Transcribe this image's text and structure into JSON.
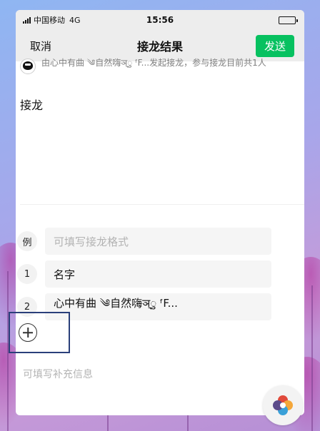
{
  "status_bar": {
    "carrier": "中国移动",
    "network": "4G",
    "time": "15:56"
  },
  "nav": {
    "cancel_label": "取消",
    "title": "接龙结果",
    "send_label": "发送"
  },
  "initiator": {
    "text": "由心中有曲 ༄自然嗨ञ्ु ᶠF...发起接龙，参与接龙目前共1人"
  },
  "topic": {
    "text": "接龙"
  },
  "rows": [
    {
      "badge": "例",
      "text": "可填写接龙格式",
      "placeholder": true
    },
    {
      "badge": "1",
      "text": "名字",
      "placeholder": false
    },
    {
      "badge": "2",
      "text": "心中有曲 ༄自然嗨ञ्ु ᶠF...",
      "placeholder": false
    }
  ],
  "supplement": {
    "placeholder": "可填写补充信息"
  },
  "colors": {
    "accent": "#07c160",
    "highlight_border": "#2a3f7a"
  },
  "icons": {
    "add": "plus-circle-icon",
    "floating": "multicolor-flower-icon"
  }
}
